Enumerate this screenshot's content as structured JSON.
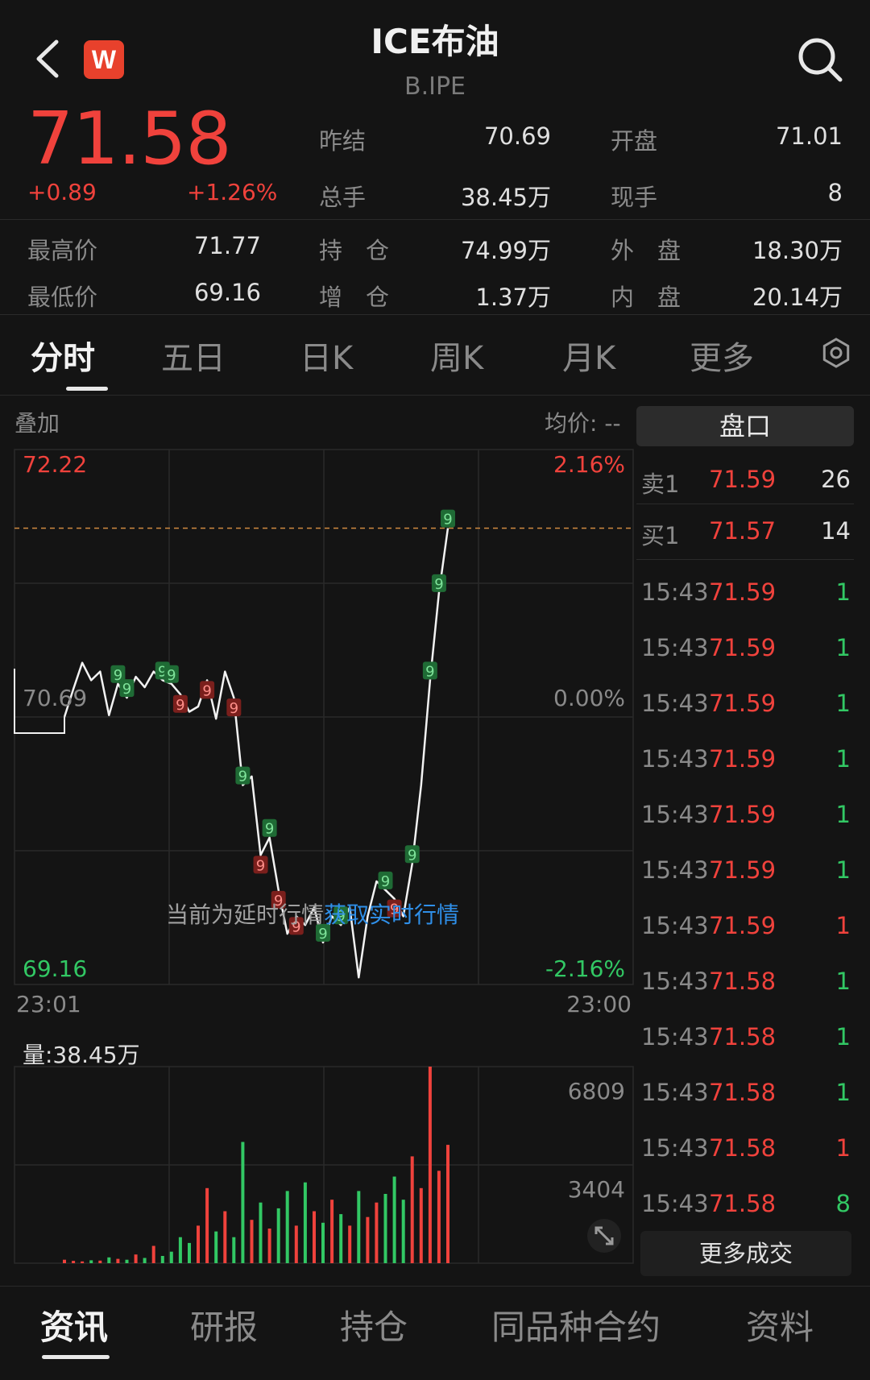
{
  "header": {
    "title": "ICE布油",
    "subtitle": "B.IPE",
    "logo_letter": "W",
    "icons": {
      "back": "chevron-left-icon",
      "search": "search-icon",
      "settings": "gear-icon",
      "expand": "expand-icon"
    }
  },
  "quote": {
    "price": "71.58",
    "change": "+0.89",
    "change_pct": "+1.26%",
    "stats": [
      {
        "label": "昨结",
        "value": "70.69"
      },
      {
        "label": "开盘",
        "value": "71.01"
      },
      {
        "label": "总手",
        "value": "38.45万"
      },
      {
        "label": "现手",
        "value": "8"
      },
      {
        "label": "最高价",
        "value": "71.77"
      },
      {
        "label": "持　仓",
        "value": "74.99万"
      },
      {
        "label": "外　盘",
        "value": "18.30万"
      },
      {
        "label": "最低价",
        "value": "69.16"
      },
      {
        "label": "增　仓",
        "value": "1.37万"
      },
      {
        "label": "内　盘",
        "value": "20.14万"
      }
    ]
  },
  "tabs": [
    "分时",
    "五日",
    "日K",
    "周K",
    "月K",
    "更多"
  ],
  "chart": {
    "overlay_label": "叠加",
    "avg_label": "均价: --",
    "price_high": "72.22",
    "price_mid": "70.69",
    "price_low": "69.16",
    "pct_high": "2.16%",
    "pct_mid": "0.00%",
    "pct_low": "-2.16%",
    "time_start": "23:01",
    "time_end": "23:00",
    "volume_label": "量:38.45万",
    "vol_max": "6809",
    "vol_mid": "3404",
    "delay_notice": "当前为延时行情",
    "realtime_link": "获取实时行情",
    "marker_text": "9"
  },
  "chart_data": {
    "type": "line",
    "title": "",
    "xlabel": "",
    "ylabel": "",
    "x_range": [
      "23:01",
      "23:00"
    ],
    "ylim": [
      69.16,
      72.22
    ],
    "reference_price": 70.69,
    "series": [
      {
        "values": [
          70.69,
          70.85,
          71.0,
          70.9,
          70.95,
          70.7,
          70.88,
          70.8,
          70.92,
          70.86,
          70.95,
          70.9,
          70.88,
          70.82,
          70.72,
          70.75,
          70.9,
          70.68,
          70.95,
          70.8,
          70.3,
          70.35,
          69.9,
          70.0,
          69.7,
          69.45,
          69.55,
          69.5,
          69.6,
          69.4,
          69.55,
          69.5,
          69.6,
          69.2,
          69.55,
          69.75,
          69.7,
          69.65,
          69.55,
          69.85,
          70.3,
          70.9,
          71.4,
          71.77
        ]
      }
    ],
    "volume": {
      "ylim": [
        0,
        6809
      ],
      "values": [
        120,
        80,
        60,
        100,
        90,
        200,
        150,
        120,
        300,
        180,
        600,
        250,
        400,
        900,
        700,
        1300,
        2600,
        1100,
        1800,
        900,
        4200,
        1500,
        2100,
        1200,
        1900,
        2500,
        1300,
        2800,
        1800,
        1400,
        2200,
        1700,
        1300,
        2500,
        1600,
        2100,
        2400,
        3000,
        2200,
        3700,
        2600,
        6809,
        3200,
        4100
      ]
    }
  },
  "order_book": {
    "title": "盘口",
    "asks": [
      {
        "label": "卖1",
        "price": "71.59",
        "vol": "26"
      }
    ],
    "bids": [
      {
        "label": "买1",
        "price": "71.57",
        "vol": "14"
      }
    ],
    "trades": [
      {
        "time": "15:43",
        "price": "71.59",
        "vol": "1",
        "side": "buy"
      },
      {
        "time": "15:43",
        "price": "71.59",
        "vol": "1",
        "side": "buy"
      },
      {
        "time": "15:43",
        "price": "71.59",
        "vol": "1",
        "side": "buy"
      },
      {
        "time": "15:43",
        "price": "71.59",
        "vol": "1",
        "side": "buy"
      },
      {
        "time": "15:43",
        "price": "71.59",
        "vol": "1",
        "side": "buy"
      },
      {
        "time": "15:43",
        "price": "71.59",
        "vol": "1",
        "side": "buy"
      },
      {
        "time": "15:43",
        "price": "71.59",
        "vol": "1",
        "side": "sell"
      },
      {
        "time": "15:43",
        "price": "71.58",
        "vol": "1",
        "side": "buy"
      },
      {
        "time": "15:43",
        "price": "71.58",
        "vol": "1",
        "side": "buy"
      },
      {
        "time": "15:43",
        "price": "71.58",
        "vol": "1",
        "side": "buy"
      },
      {
        "time": "15:43",
        "price": "71.58",
        "vol": "1",
        "side": "sell"
      },
      {
        "time": "15:43",
        "price": "71.58",
        "vol": "8",
        "side": "buy"
      }
    ],
    "more_label": "更多成交"
  },
  "bottom_nav": [
    "资讯",
    "研报",
    "持仓",
    "同品种合约",
    "资料"
  ],
  "colors": {
    "up": "#f0423c",
    "down": "#32c864",
    "background": "#141414",
    "link": "#2f8fe8"
  }
}
